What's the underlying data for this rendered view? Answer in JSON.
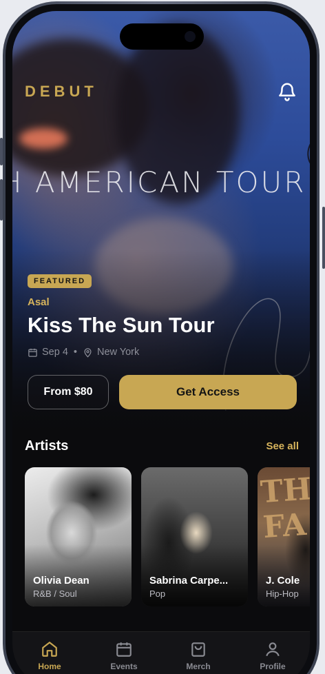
{
  "app": {
    "brand": "DEBUT"
  },
  "hero": {
    "banner_text": "H AMERICAN TOUR",
    "badge": "FEATURED",
    "artist": "Asal",
    "title": "Kiss The Sun Tour",
    "date": "Sep 4",
    "separator": "•",
    "location": "New York",
    "price_button": "From $80",
    "cta_button": "Get Access"
  },
  "artists": {
    "title": "Artists",
    "see_all": "See all",
    "items": [
      {
        "name": "Olivia Dean",
        "genre": "R&B / Soul"
      },
      {
        "name": "Sabrina Carpe...",
        "genre": "Pop"
      },
      {
        "name": "J. Cole",
        "genre": "Hip-Hop"
      }
    ],
    "jcole_art_text": "THE FA"
  },
  "tabs": [
    {
      "label": "Home",
      "icon": "home-icon",
      "active": true
    },
    {
      "label": "Events",
      "icon": "calendar-icon",
      "active": false
    },
    {
      "label": "Merch",
      "icon": "bag-icon",
      "active": false
    },
    {
      "label": "Profile",
      "icon": "user-icon",
      "active": false
    }
  ],
  "colors": {
    "accent": "#c8a753",
    "background": "#0b0b0d",
    "tab_inactive": "#8a8b92"
  }
}
